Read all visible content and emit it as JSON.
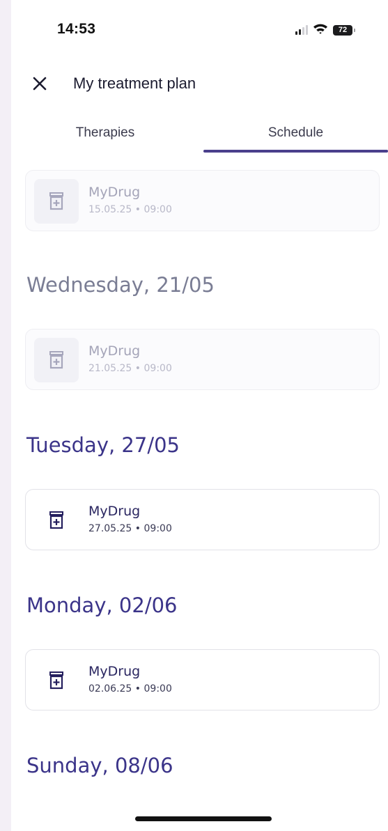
{
  "status_bar": {
    "time": "14:53",
    "battery": "72",
    "icons": [
      "signal-icon",
      "wifi-icon",
      "battery-icon"
    ]
  },
  "header": {
    "title": "My treatment plan",
    "close_icon": "close-icon"
  },
  "tabs": [
    {
      "label": "Therapies",
      "selected": false
    },
    {
      "label": "Schedule",
      "selected": true
    }
  ],
  "schedule": {
    "first_entry": {
      "name": "MyDrug",
      "datetime": "15.05.25 • 09:00",
      "past": true
    },
    "days": [
      {
        "heading": "Wednesday, 21/05",
        "past": true,
        "entries": [
          {
            "name": "MyDrug",
            "datetime": "21.05.25 • 09:00"
          }
        ]
      },
      {
        "heading": "Tuesday, 27/05",
        "past": false,
        "entries": [
          {
            "name": "MyDrug",
            "datetime": "27.05.25 • 09:00"
          }
        ]
      },
      {
        "heading": "Monday, 02/06",
        "past": false,
        "entries": [
          {
            "name": "MyDrug",
            "datetime": "02.06.25 • 09:00"
          }
        ]
      },
      {
        "heading": "Sunday, 08/06",
        "past": false,
        "entries": []
      }
    ]
  },
  "colors": {
    "accent": "#4a3f8c",
    "heading": "#3b3489",
    "heading_past": "#7a7d94",
    "text_past": "#a4a4b8"
  }
}
